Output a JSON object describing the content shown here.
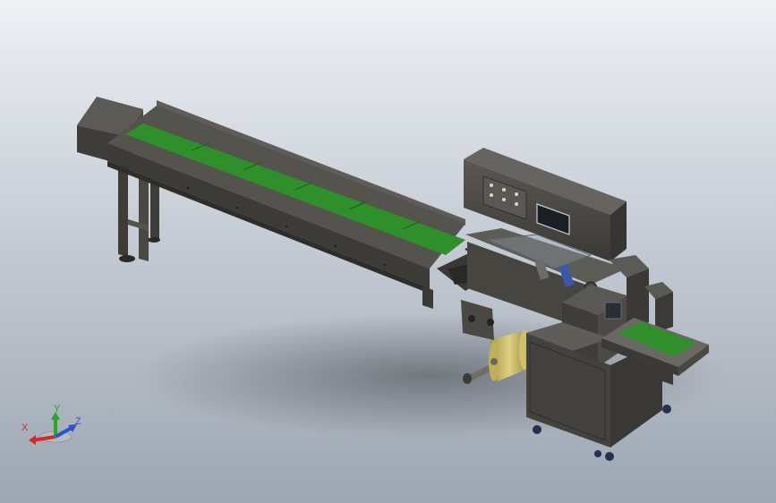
{
  "viewport": {
    "background_top": "#eef1f5",
    "background_bottom": "#9da6b2"
  },
  "model": {
    "body_color": "#4a4843",
    "belt_color": "#2f8f2a",
    "film_roll_color": "#c9b760",
    "panel_color": "#3b3935"
  },
  "triad": {
    "x_label": "X",
    "y_label": "Y",
    "z_label": "Z",
    "x_color": "#d32b2b",
    "y_color": "#2aa52a",
    "z_color": "#2d55c8"
  }
}
